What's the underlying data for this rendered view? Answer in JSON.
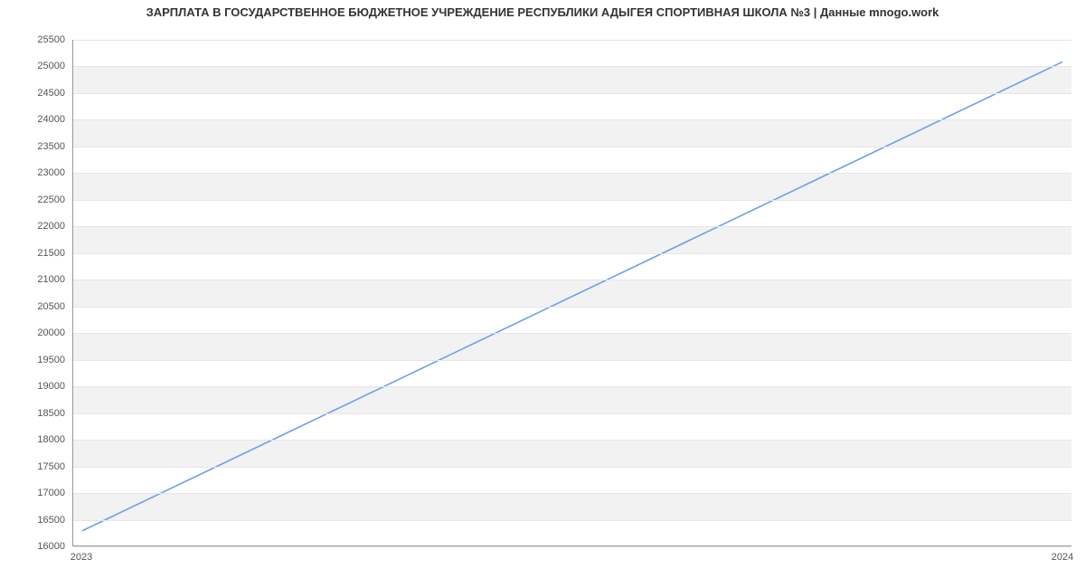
{
  "chart_data": {
    "type": "line",
    "title": "ЗАРПЛАТА В ГОСУДАРСТВЕННОЕ БЮДЖЕТНОЕ УЧРЕЖДЕНИЕ РЕСПУБЛИКИ АДЫГЕЯ СПОРТИВНАЯ ШКОЛА №3 | Данные mnogo.work",
    "xlabel": "",
    "ylabel": "",
    "x_categories": [
      "2023",
      "2024"
    ],
    "x": [
      0,
      1
    ],
    "series": [
      {
        "name": "Зарплата",
        "values": [
          16276,
          25085
        ],
        "color": "#6f9fe8"
      }
    ],
    "ylim": [
      16000,
      25500
    ],
    "y_ticks": [
      16000,
      16500,
      17000,
      17500,
      18000,
      18500,
      19000,
      19500,
      20000,
      20500,
      21000,
      21500,
      22000,
      22500,
      23000,
      23500,
      24000,
      24500,
      25000,
      25500
    ],
    "grid": true,
    "legend": false
  }
}
